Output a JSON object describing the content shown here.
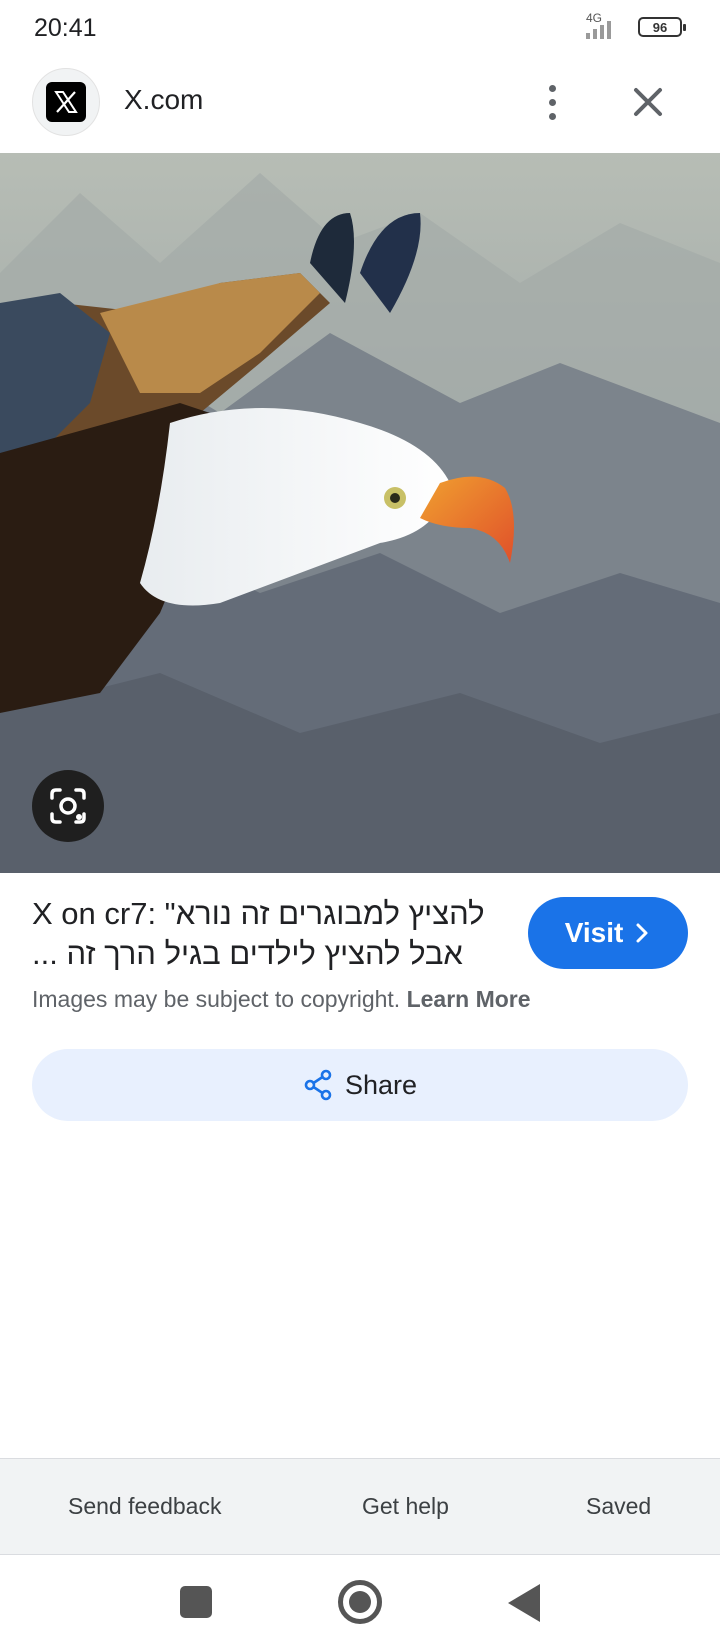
{
  "status_bar": {
    "time": "20:41",
    "network": "4G",
    "battery": "96"
  },
  "header": {
    "site_name": "X.com",
    "logo_icon": "x-logo-icon",
    "more_icon": "more-vert-icon",
    "close_icon": "close-icon"
  },
  "image": {
    "subject": "bald-eagle-photo"
  },
  "result": {
    "title_line1": "X on cr7: \"להציץ למבוגרים זה נורא",
    "title_line2": "אבל להציץ לילדים בגיל הרך זה ...",
    "visit_label": "Visit",
    "copyright_text": "Images may be subject to copyright.",
    "learn_more": "Learn More",
    "share_label": "Share"
  },
  "footer": {
    "send_feedback": "Send feedback",
    "get_help": "Get help",
    "saved": "Saved"
  },
  "colors": {
    "accent": "#1a73e8",
    "share_bg": "#e8f0fe",
    "footer_bg": "#f1f3f4"
  }
}
